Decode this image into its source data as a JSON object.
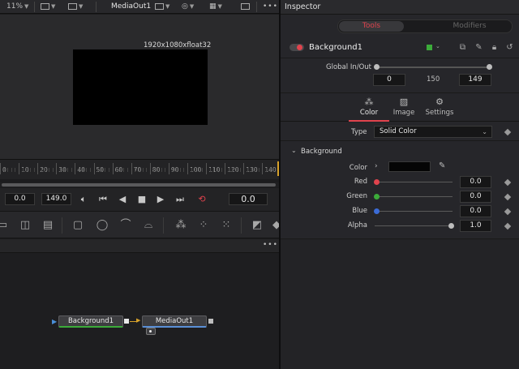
{
  "viewer": {
    "zoom": "11%",
    "viewer_name": "MediaOut1",
    "frame_label": "1920x1080xfloat32",
    "ruler_ticks": [
      "0",
      "10",
      "20",
      "30",
      "40",
      "50",
      "60",
      "70",
      "80",
      "90",
      "100",
      "110",
      "120",
      "130",
      "140"
    ]
  },
  "transport": {
    "start": "0.0",
    "end": "149.0",
    "current": "0.0"
  },
  "nodes": {
    "background": "Background1",
    "mediaout": "MediaOut1"
  },
  "inspector": {
    "title": "Inspector",
    "tabs": {
      "tools": "Tools",
      "modifiers": "Modifiers"
    },
    "tool_name": "Background1",
    "global_label": "Global In/Out",
    "global_in": "0",
    "global_mid": "150",
    "global_out": "149",
    "subtabs": {
      "color": "Color",
      "image": "Image",
      "settings": "Settings"
    },
    "type_label": "Type",
    "type_value": "Solid Color",
    "section": "Background",
    "params": {
      "color_label": "Color",
      "red_label": "Red",
      "red_value": "0.0",
      "green_label": "Green",
      "green_value": "0.0",
      "blue_label": "Blue",
      "blue_value": "0.0",
      "alpha_label": "Alpha",
      "alpha_value": "1.0"
    },
    "colors": {
      "accent": "#e0434d",
      "red": "#e0434d",
      "green": "#3cab3a",
      "blue": "#3b6bd6",
      "alpha": "#bdbdbd"
    }
  },
  "icons": [
    "speaker-icon",
    "skip-start-icon",
    "step-back-icon",
    "stop-icon",
    "play-icon",
    "skip-end-icon",
    "loop-icon",
    "eyedropper-icon",
    "pin-icon",
    "lock-icon",
    "reset-icon",
    "more-icon"
  ]
}
